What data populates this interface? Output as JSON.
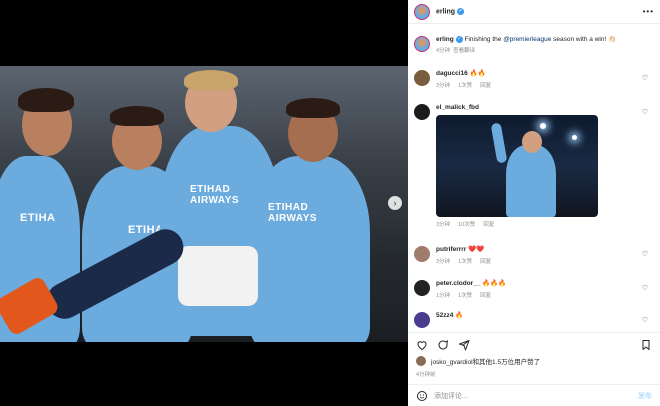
{
  "post": {
    "author": "erling",
    "caption_prefix": "Finishing the ",
    "caption_mention": "@premierleague",
    "caption_suffix": " season with a win! 👏🏻",
    "caption_time": "4分钟",
    "translate": "查看翻译",
    "sponsor_text": "ETIHAD AIRWAYS",
    "sponsor_short": "ETIHA"
  },
  "comments": [
    {
      "user": "dagucci16",
      "text": "🔥🔥",
      "time": "3分钟",
      "likes": "1次赞",
      "reply": "回复",
      "avatar_color": "#7a5c3e"
    },
    {
      "user": "el_malick_fbd",
      "text": "",
      "time": "3分钟",
      "likes": "10次赞",
      "reply": "回复",
      "avatar_color": "#1b1b1b"
    },
    {
      "user": "putriferrrr",
      "text": "❤️❤️",
      "time": "3分钟",
      "likes": "1次赞",
      "reply": "回复",
      "avatar_color": "#a07a6a"
    },
    {
      "user": "peter.clodor__",
      "text": "🔥🔥🔥",
      "time": "1分钟",
      "likes": "1次赞",
      "reply": "回复",
      "avatar_color": "#222222"
    },
    {
      "user": "52zz4",
      "text": "🔥",
      "time": "",
      "likes": "",
      "reply": "",
      "avatar_color": "#4a3c8c"
    }
  ],
  "actions": {
    "liked_by": "josko_gvardiol和其他1.5万位用户赞了",
    "time": "4分钟前",
    "add_comment_placeholder": "添加评论...",
    "post_button": "发布"
  },
  "icons": {
    "more": "more-horizontal-icon",
    "like": "heart-icon",
    "comment": "comment-icon",
    "share": "share-icon",
    "save": "bookmark-icon",
    "emoji": "emoji-icon",
    "next": "chevron-right-icon"
  },
  "colors": {
    "jersey": "#6cabdd",
    "verified": "#3897f0",
    "mention": "#00376b",
    "post_button": "#b2dffc",
    "heart_emoji": "#e0245e"
  }
}
